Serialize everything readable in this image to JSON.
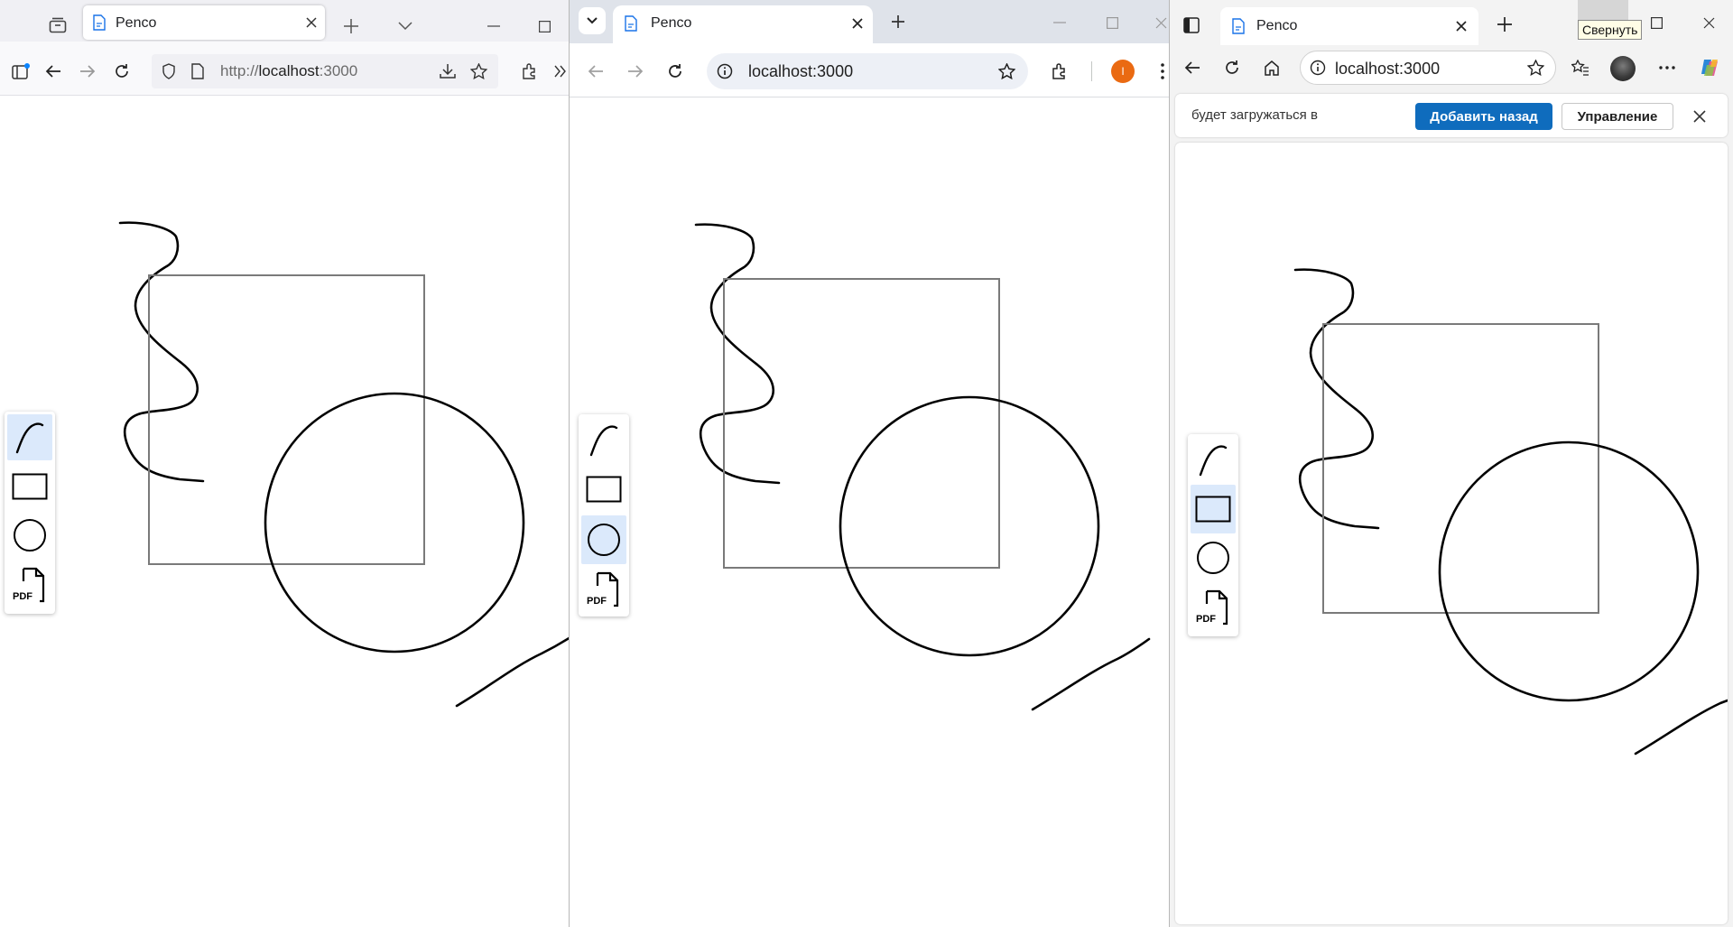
{
  "windows": [
    {
      "id": "firefox",
      "tab_title": "Penco",
      "url_scheme": "http://",
      "url_host": "localhost",
      "url_port": ":3000",
      "active_tool": "pen"
    },
    {
      "id": "chrome",
      "tab_title": "Penco",
      "url": "localhost:3000",
      "profile_initial": "I",
      "active_tool": "circle"
    },
    {
      "id": "edge",
      "tab_title": "Penco",
      "url": "localhost:3000",
      "active_tool": "rectangle",
      "tooltip": "Свернуть",
      "infobar": {
        "message": "будет загружаться в",
        "add_back_label": "Добавить назад",
        "manage_label": "Управление"
      }
    }
  ],
  "toolbar": {
    "tools": [
      "pen",
      "rectangle",
      "circle",
      "pdf"
    ],
    "pdf_label": "PDF"
  },
  "colors": {
    "firefox_chrome": "#f0f0f4",
    "chrome_chrome": "#dfe3ea",
    "chrome_toolbar": "#ffffff",
    "edge_chrome": "#f3f3f3",
    "accent_blue": "#0f6cbd",
    "tool_active_bg": "#dbe9fb",
    "profile_orange": "#ea6a12"
  }
}
